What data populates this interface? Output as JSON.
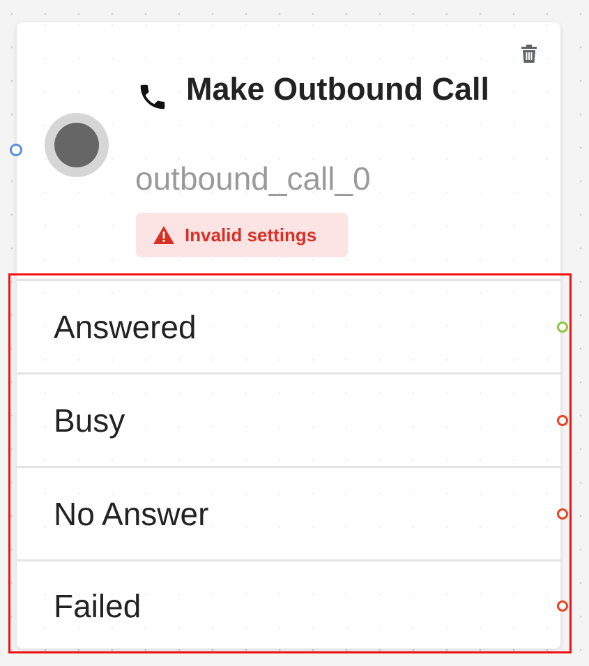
{
  "node": {
    "title": "Make Outbound Call",
    "id": "outbound_call_0",
    "icon": "phone-icon",
    "status_icon": "status-indicator",
    "delete_icon": "trash-icon",
    "warning": {
      "text": "Invalid settings",
      "icon": "warning-triangle-icon",
      "color": "#d93025",
      "background": "#fde4e4"
    },
    "input_port_color": "#5b8fd6",
    "outputs": [
      {
        "label": "Answered",
        "port_color": "#8cc63f"
      },
      {
        "label": "Busy",
        "port_color": "#e8431f"
      },
      {
        "label": "No Answer",
        "port_color": "#e8431f"
      },
      {
        "label": "Failed",
        "port_color": "#e8431f"
      }
    ]
  },
  "highlight_color": "#ee1111"
}
